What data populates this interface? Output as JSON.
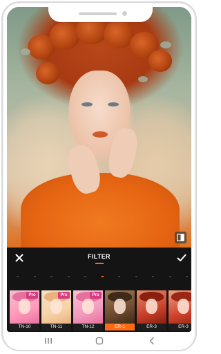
{
  "editor": {
    "title": "FILTER",
    "close_icon": "close-icon",
    "confirm_icon": "check-icon",
    "compare_icon": "compare-icon",
    "accent_color": "#ff6a13"
  },
  "intensity_slider": {
    "tick_count": 11,
    "active_index": 5
  },
  "filters": [
    {
      "label": "TN-10",
      "pro": true,
      "pro_label": "Pro",
      "selected": false
    },
    {
      "label": "TN-11",
      "pro": true,
      "pro_label": "Pro",
      "selected": false
    },
    {
      "label": "TN-12",
      "pro": true,
      "pro_label": "Pro",
      "selected": false
    },
    {
      "label": "ER-1",
      "pro": false,
      "selected": true
    },
    {
      "label": "ER-3",
      "pro": false,
      "selected": false
    },
    {
      "label": "ER-3",
      "pro": false,
      "selected": false
    }
  ],
  "system_nav": {
    "recents_icon": "recents-icon",
    "home_icon": "home-icon",
    "back_icon": "back-icon"
  }
}
